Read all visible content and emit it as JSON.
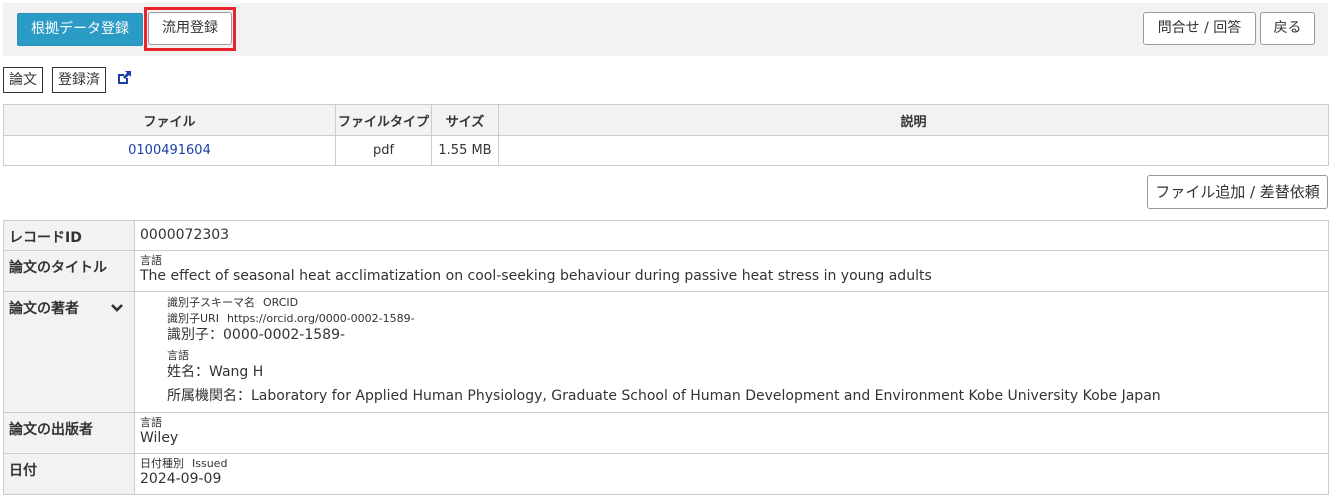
{
  "toolbar": {
    "evidence_register": "根拠データ登録",
    "reuse_register": "流用登録",
    "inquiry": "問合せ / 回答",
    "back": "戻る"
  },
  "tags": {
    "type": "論文",
    "status": "登録済"
  },
  "icons": {
    "external_link": "external-link-icon",
    "expand": "chevron-down-icon"
  },
  "colors": {
    "primary": "#2a9bc4",
    "highlight": "#e8242d",
    "link": "#1a3fa8"
  },
  "files": {
    "headers": [
      "ファイル",
      "ファイルタイプ",
      "サイズ",
      "説明"
    ],
    "rows": [
      {
        "file": "0100491604",
        "type": "pdf",
        "size": "1.55 MB",
        "description": ""
      }
    ]
  },
  "add_file_button": "ファイル追加 / 差替依頼",
  "record": {
    "record_id": {
      "label": "レコードID",
      "value": "0000072303"
    },
    "title": {
      "label": "論文のタイトル",
      "lang_label": "言語",
      "value": "The effect of seasonal heat acclimatization on cool-seeking behaviour during passive heat stress in young adults"
    },
    "author": {
      "label": "論文の著者",
      "scheme_label": "識別子スキーマ名",
      "scheme_value": "ORCID",
      "uri_label": "識別子URI",
      "uri_value": "https://orcid.org/0000-0002-1589-",
      "identifier": "識別子：0000-0002-1589-",
      "lang_label": "言語",
      "name": "姓名：Wang H",
      "affiliation": "所属機関名：Laboratory for Applied Human Physiology, Graduate School of Human Development and Environment Kobe University Kobe Japan"
    },
    "publisher": {
      "label": "論文の出版者",
      "lang_label": "言語",
      "value": "Wiley"
    },
    "date": {
      "label": "日付",
      "type_label": "日付種別",
      "type_value": "Issued",
      "value": "2024-09-09"
    }
  }
}
